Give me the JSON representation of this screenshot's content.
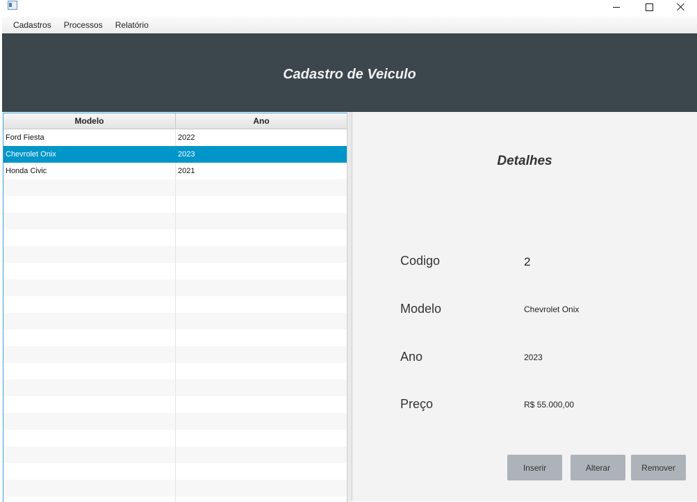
{
  "window": {
    "minimize_glyph": "",
    "icons": [
      "app-icon",
      "minimize-icon",
      "maximize-icon",
      "close-icon"
    ]
  },
  "menubar": {
    "items": [
      {
        "label": "Cadastros"
      },
      {
        "label": "Processos"
      },
      {
        "label": "Relatório"
      }
    ]
  },
  "header": {
    "title": "Cadastro de Veiculo",
    "background": "#3b464d"
  },
  "table": {
    "columns": [
      "Modelo",
      "Ano"
    ],
    "rows": [
      {
        "modelo": "Ford Fiesta",
        "ano": "2022"
      },
      {
        "modelo": "Chevrolet Onix",
        "ano": "2023",
        "selected": true
      },
      {
        "modelo": "Honda Civic",
        "ano": "2021"
      }
    ],
    "selection_color": "#0096c9"
  },
  "details": {
    "title": "Detalhes",
    "fields": {
      "codigo": {
        "label": "Codigo",
        "value": "2"
      },
      "modelo": {
        "label": "Modelo",
        "value": "Chevrolet Onix"
      },
      "ano": {
        "label": "Ano",
        "value": "2023"
      },
      "preco": {
        "label": "Preço",
        "value": "R$ 55.000,00"
      }
    },
    "buttons": {
      "inserir": "Inserir",
      "alterar": "Alterar",
      "remover": "Remover"
    }
  }
}
